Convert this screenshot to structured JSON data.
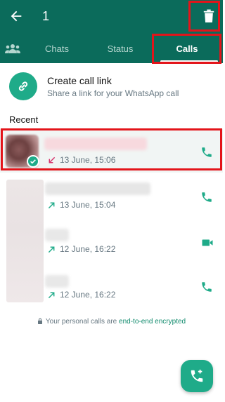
{
  "appbar": {
    "selected_count": "1"
  },
  "tabs": {
    "chats": "Chats",
    "status": "Status",
    "calls": "Calls"
  },
  "create_link": {
    "title": "Create call link",
    "subtitle": "Share a link for your WhatsApp call"
  },
  "recent_label": "Recent",
  "calls": [
    {
      "time": "13 June, 15:06",
      "direction": "missed-incoming",
      "type": "voice",
      "selected": true
    },
    {
      "time": "13 June, 15:04",
      "direction": "outgoing",
      "type": "voice",
      "selected": false
    },
    {
      "time": "12 June, 16:22",
      "direction": "outgoing",
      "type": "video",
      "selected": false
    },
    {
      "time": "12 June, 16:22",
      "direction": "outgoing",
      "type": "voice",
      "selected": false
    }
  ],
  "footer": {
    "text": "Your personal calls are ",
    "link": "end-to-end encrypted"
  },
  "colors": {
    "header": "#0b6b5b",
    "accent": "#1fab89",
    "missed": "#d6336c",
    "highlight": "#e3141a"
  },
  "icons": {
    "back": "arrow-left-icon",
    "delete": "trash-icon",
    "community": "community-icon",
    "link": "link-icon",
    "voice_call": "phone-icon",
    "video_call": "video-icon",
    "new_call": "add-call-icon",
    "lock": "lock-icon"
  }
}
